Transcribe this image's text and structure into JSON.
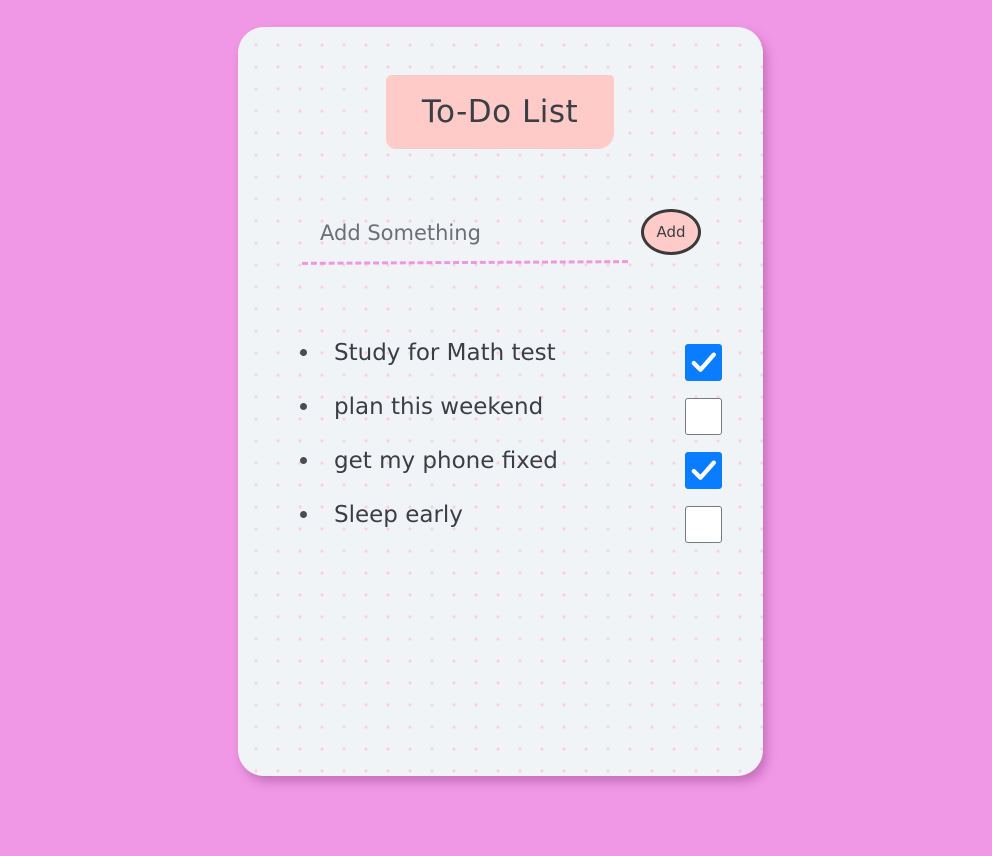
{
  "app": {
    "title": "To-Do List"
  },
  "add_form": {
    "placeholder": "Add Something",
    "value": "",
    "button_label": "Add"
  },
  "todos": [
    {
      "text": "Study for Math test",
      "checked": true
    },
    {
      "text": "plan this weekend",
      "checked": false
    },
    {
      "text": "get my phone fixed",
      "checked": true
    },
    {
      "text": "Sleep early",
      "checked": false
    }
  ],
  "colors": {
    "page_background": "#f098e6",
    "card_background": "#f1f4f7",
    "title_background": "#ffcbc8",
    "checkbox_checked": "#0a7cff",
    "input_underline": "#ef96df",
    "text": "#3b3f44"
  }
}
